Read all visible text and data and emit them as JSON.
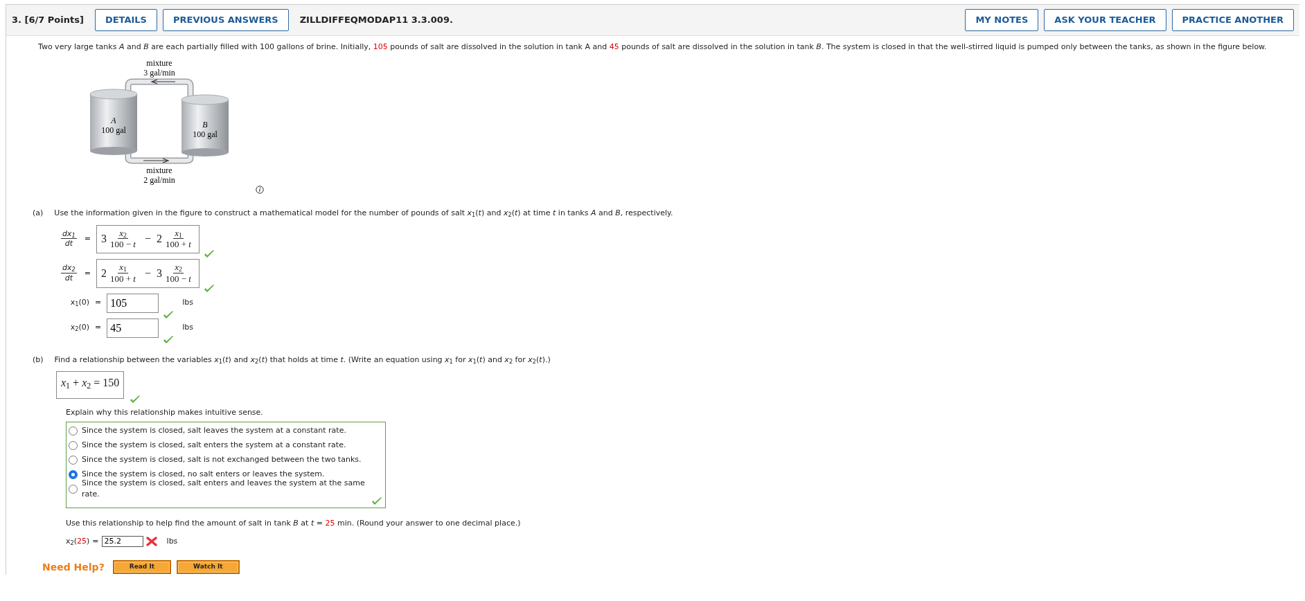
{
  "header": {
    "number": "3. [6/7 Points]",
    "left_buttons": [
      "DETAILS",
      "PREVIOUS ANSWERS"
    ],
    "code": "ZILLDIFFEQMODAP11 3.3.009.",
    "right_buttons": [
      "MY NOTES",
      "ASK YOUR TEACHER",
      "PRACTICE ANOTHER"
    ]
  },
  "intro": [
    {
      "kind": "plain",
      "text": "Two very large tanks *A* and *B* are each partially filled with 100 gallons of brine. Initially, "
    },
    {
      "kind": "given",
      "text": "105"
    },
    {
      "kind": "plain",
      "text": " pounds of salt are dissolved in the solution in tank A and "
    },
    {
      "kind": "given",
      "text": "45"
    },
    {
      "kind": "plain",
      "text": " pounds of salt are dissolved in the solution in tank *B*. The system is closed in that the well-stirred liquid is pumped only between the tanks, as shown in the figure below."
    }
  ],
  "figure": {
    "top_label": [
      "mixture",
      "3 gal/min"
    ],
    "tanks": [
      {
        "letter": "A",
        "volume": "100 gal"
      },
      {
        "letter": "B",
        "volume": "100 gal"
      }
    ],
    "bottom_label": [
      "mixture",
      "2 gal/min"
    ]
  },
  "part_a": {
    "label": "(a)",
    "prompt": "Use the information given in the figure to construct a mathematical model for the number of pounds of salt *x*$_{1}$(*t*) and *x*$_{2}$(*t*) at time *t* in tanks *A* and *B*, respectively.",
    "equations": [
      {
        "lhs_num": "dx$_{1}$",
        "lhs_den": "dt",
        "eq": "=",
        "terms": [
          {
            "coef": "3",
            "num": "*x*$_{2}$",
            "den": "100 − *t*"
          },
          {
            "sign": "−",
            "coef": "2",
            "num": "*x*$_{1}$",
            "den": "100 + *t*"
          }
        ],
        "correct": true
      },
      {
        "lhs_num": "dx$_{2}$",
        "lhs_den": "dt",
        "eq": "=",
        "terms": [
          {
            "coef": "2",
            "num": "*x*$_{1}$",
            "den": "100 + *t*"
          },
          {
            "sign": "−",
            "coef": "3",
            "num": "*x*$_{2}$",
            "den": "100 − *t*"
          }
        ],
        "correct": true
      }
    ],
    "initial": [
      {
        "label": "x$_{1}$(0)",
        "eq": "=",
        "value": "105",
        "unit": "lbs",
        "correct": true
      },
      {
        "label": "x$_{2}$(0)",
        "eq": "=",
        "value": "45",
        "unit": "lbs",
        "correct": true
      }
    ]
  },
  "part_b": {
    "label": "(b)",
    "prompt": "Find a relationship between the variables *x*$_{1}$(*t*) and *x*$_{2}$(*t*) that holds at time *t*. (Write an equation using *x*$_{1}$ for *x*$_{1}$(*t*) and *x*$_{2}$ for *x*$_{2}$(*t*).)",
    "answer": "*x*$_{1}$ + *x*$_{2}$ = 150",
    "answer_correct": true,
    "explain_prompt": "Explain why this relationship makes intuitive sense.",
    "options": [
      {
        "text": "Since the system is closed, salt leaves the system at a constant rate.",
        "selected": false
      },
      {
        "text": "Since the system is closed, salt enters the system at a constant rate.",
        "selected": false
      },
      {
        "text": "Since the system is closed, salt is not exchanged between the two tanks.",
        "selected": false
      },
      {
        "text": "Since the system is closed, no salt enters or leaves the system.",
        "selected": true
      },
      {
        "text": "Since the system is closed, salt enters and leaves the system at the same rate.",
        "selected": false
      }
    ],
    "options_correct": true,
    "followup": [
      {
        "kind": "plain",
        "text": "Use this relationship to help find the amount of salt in tank *B* at *t* = "
      },
      {
        "kind": "given",
        "text": "25"
      },
      {
        "kind": "plain",
        "text": " min. (Round your answer to one decimal place.)"
      }
    ],
    "final_label": [
      {
        "kind": "plain",
        "text": "x$_{2}$("
      },
      {
        "kind": "given",
        "text": "25"
      },
      {
        "kind": "plain",
        "text": ")"
      }
    ],
    "final_eq": "=",
    "final_value": "25.2",
    "final_unit": "lbs",
    "final_correct": false
  },
  "help": {
    "title": "Need Help?",
    "buttons": [
      "Read It",
      "Watch It"
    ]
  }
}
